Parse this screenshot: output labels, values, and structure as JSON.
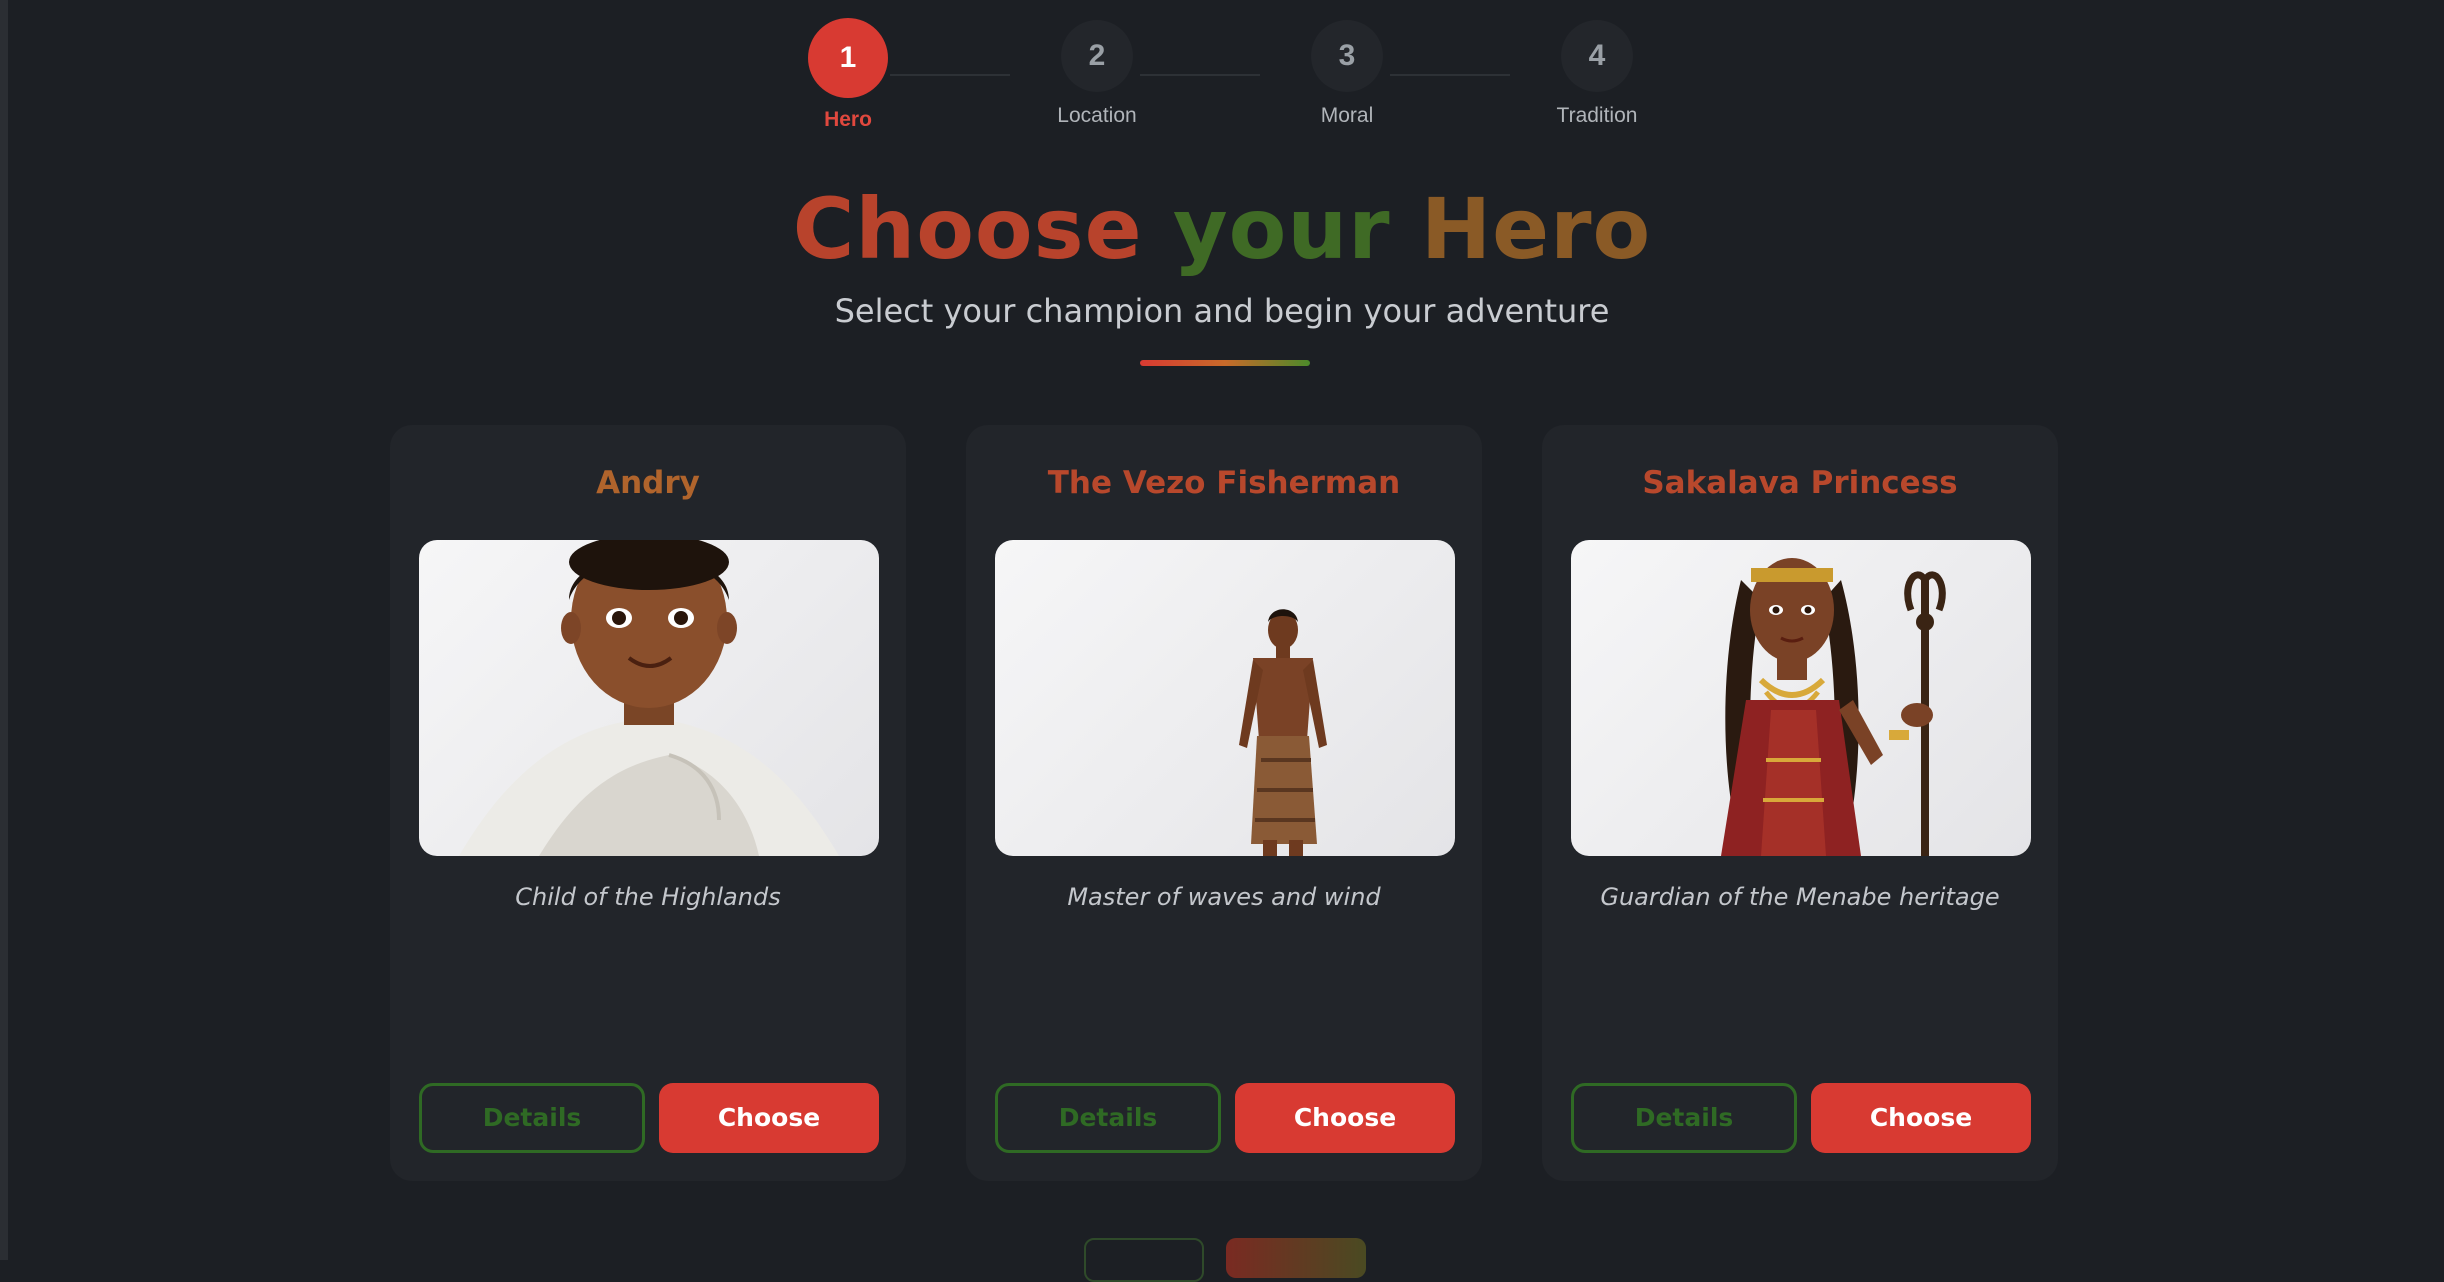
{
  "stepper": {
    "steps": [
      {
        "number": "1",
        "label": "Hero",
        "active": true
      },
      {
        "number": "2",
        "label": "Location",
        "active": false
      },
      {
        "number": "3",
        "label": "Moral",
        "active": false
      },
      {
        "number": "4",
        "label": "Tradition",
        "active": false
      }
    ]
  },
  "header": {
    "title_part1": "Choose",
    "title_part2": "your",
    "title_part3": "Hero",
    "subtitle": "Select your champion and begin your adventure"
  },
  "colors": {
    "accent_red": "#d83a32",
    "accent_green": "#2f6a24",
    "background": "#1c1f24",
    "card": "#22252a"
  },
  "heroes": [
    {
      "name": "Andry",
      "tagline": "Child of the Highlands",
      "details_label": "Details",
      "choose_label": "Choose",
      "name_color": "#b0642c"
    },
    {
      "name": "The Vezo Fisherman",
      "tagline": "Master of waves and wind",
      "details_label": "Details",
      "choose_label": "Choose",
      "name_color": "#b8482c"
    },
    {
      "name": "Sakalava Princess",
      "tagline": "Guardian of the Menabe heritage",
      "details_label": "Details",
      "choose_label": "Choose",
      "name_color": "#b8482c"
    }
  ]
}
